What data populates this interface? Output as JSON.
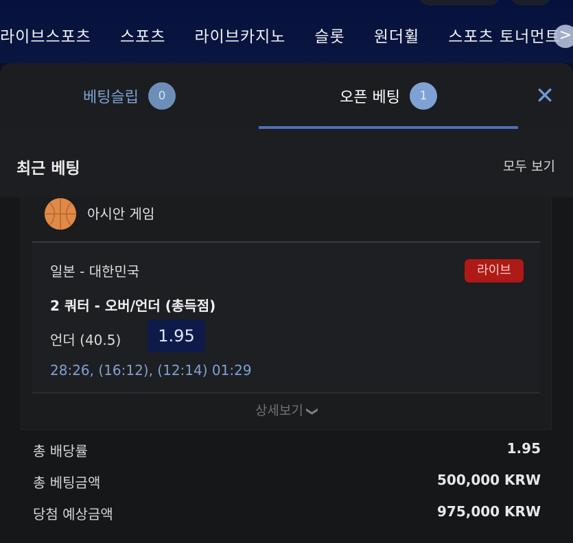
{
  "nav": {
    "items": [
      "라이브스포츠",
      "스포츠",
      "라이브카지노",
      "슬롯",
      "원더휠",
      "스포츠 토너먼트"
    ],
    "arrow": ">"
  },
  "tabs": {
    "betslip": {
      "label": "베팅슬립",
      "count": "0"
    },
    "open_bets": {
      "label": "오픈 베팅",
      "count": "1"
    },
    "close": "✕"
  },
  "recent": {
    "title": "최근 베팅",
    "view_all": "모두 보기"
  },
  "bet": {
    "league_icon": "basketball-icon",
    "league": "아시안 게임",
    "match": "일본 - 대한민국",
    "live_badge": "라이브",
    "market": "2 쿼터 - 오버/언더 (총득점)",
    "selection": "언더 (40.5)",
    "odds": "1.95",
    "score": "28:26, (16:12), (12:14) 01:29",
    "detail_label": "상세보기"
  },
  "summary": {
    "total_odds_label": "총 배당률",
    "total_odds": "1.95",
    "total_stake_label": "총 베팅금액",
    "total_stake": "500,000 KRW",
    "potential_win_label": "당첨 예상금액",
    "potential_win": "975,000 KRW"
  },
  "colors": {
    "live_badge": "#b01a16",
    "accent": "#4a72b8",
    "score": "#7ea2d6",
    "odds_bg": "#0e1b4a"
  }
}
